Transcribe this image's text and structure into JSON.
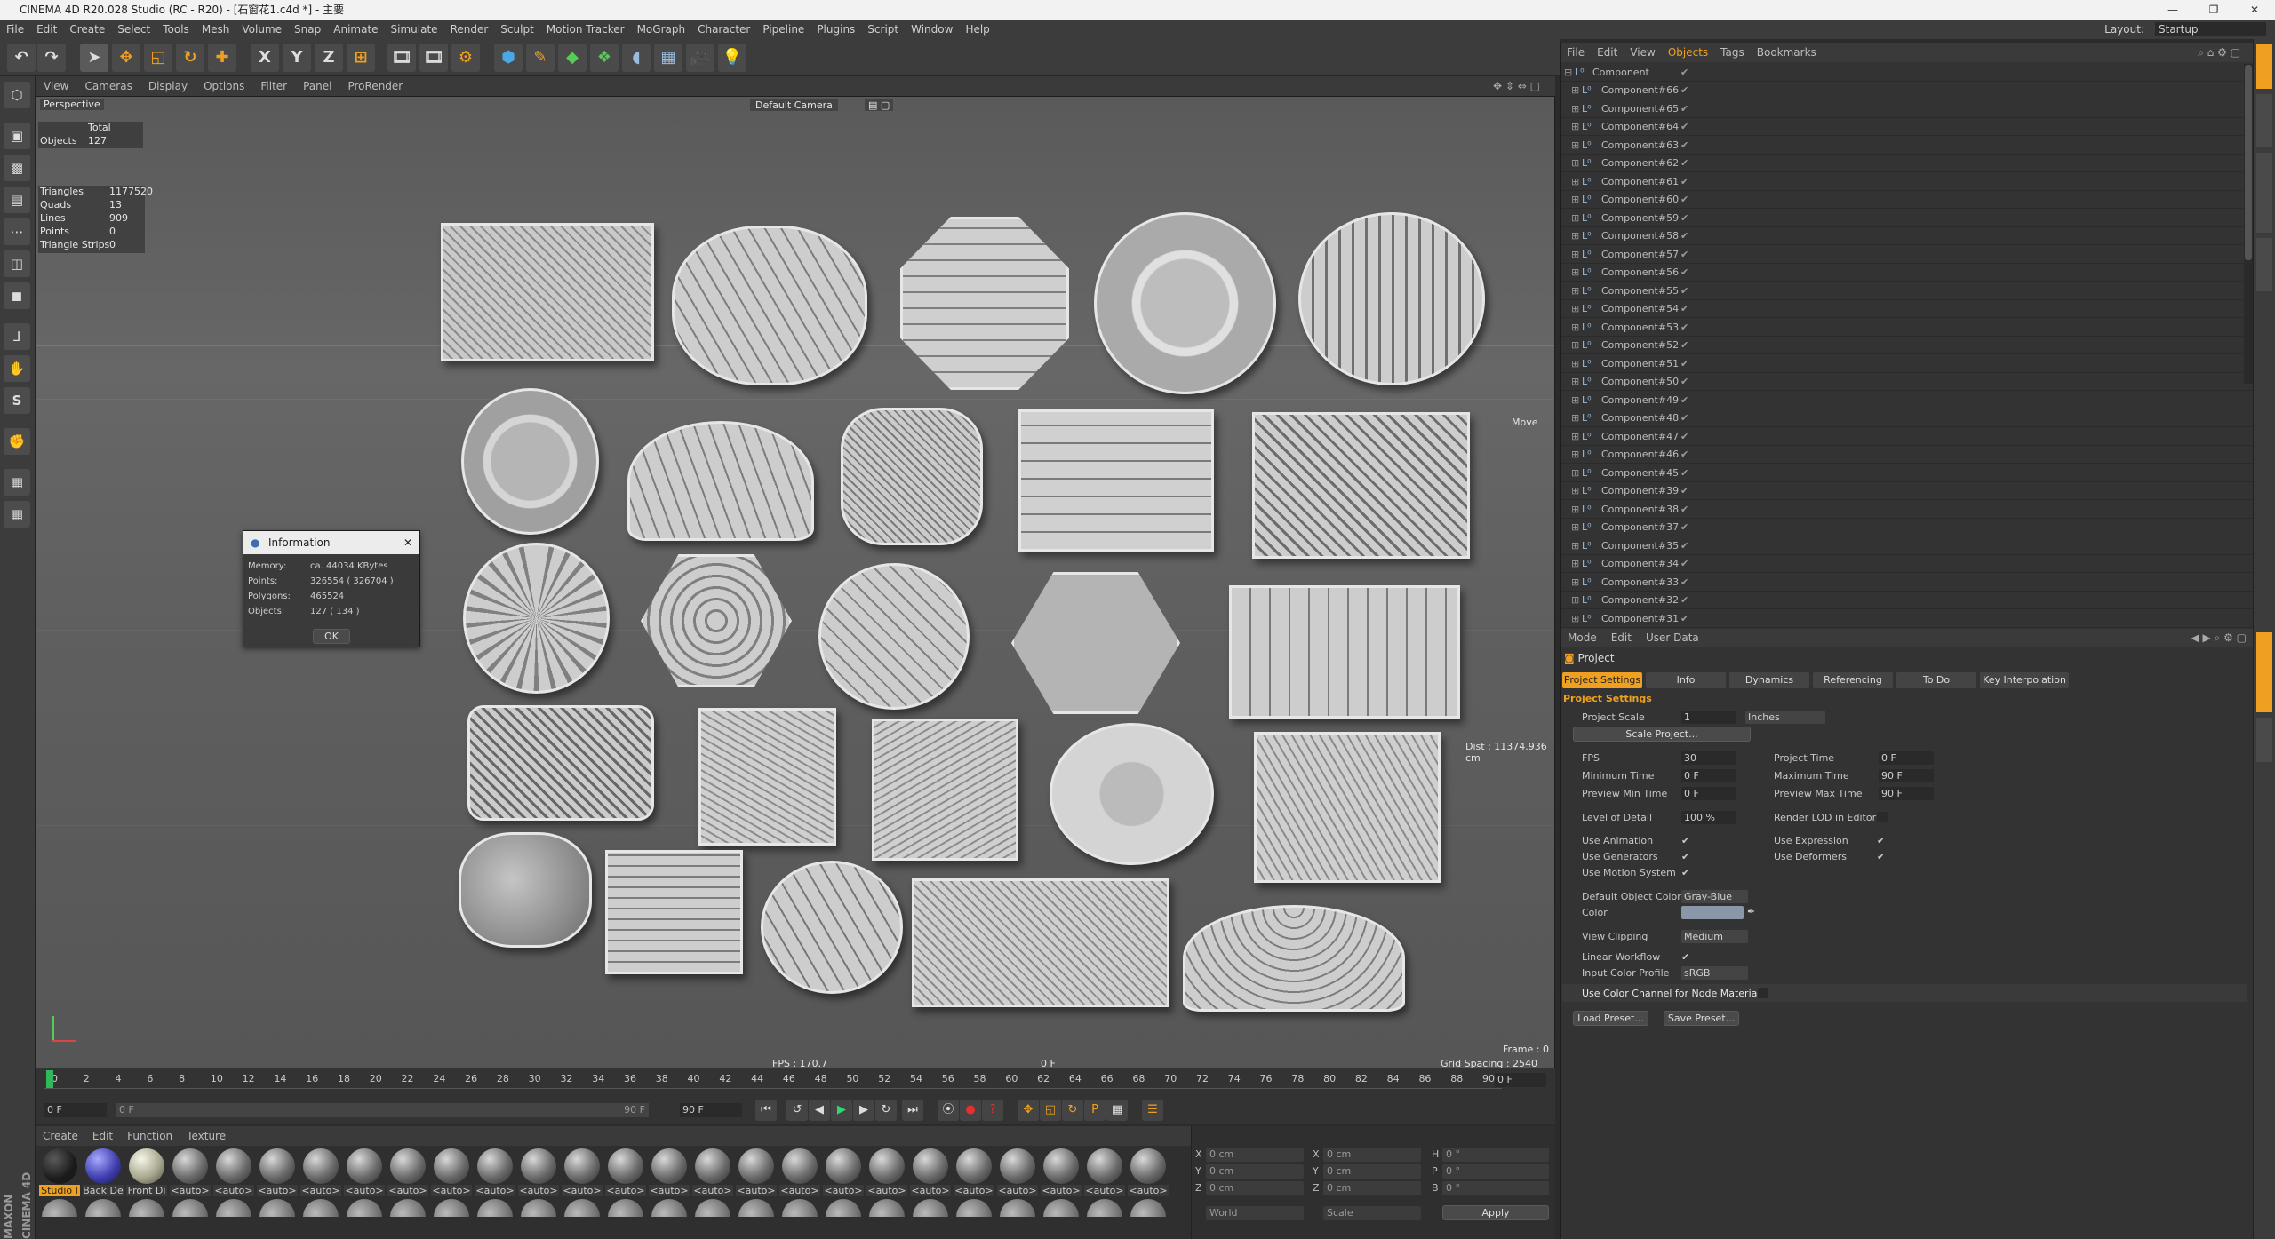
{
  "app": {
    "title": "CINEMA 4D R20.028 Studio (RC - R20) - [石窗花1.c4d *] - 主要",
    "layout_label": "Layout:",
    "layout_value": "Startup"
  },
  "menu": [
    "File",
    "Edit",
    "Create",
    "Select",
    "Tools",
    "Mesh",
    "Volume",
    "Snap",
    "Animate",
    "Simulate",
    "Render",
    "Sculpt",
    "Motion Tracker",
    "MoGraph",
    "Character",
    "Pipeline",
    "Plugins",
    "Script",
    "Window",
    "Help"
  ],
  "toolbar": {
    "x_label": "X",
    "y_label": "Y",
    "z_label": "Z"
  },
  "viewport": {
    "menu": [
      "View",
      "Cameras",
      "Display",
      "Options",
      "Filter",
      "Panel",
      "ProRender"
    ],
    "name": "Perspective",
    "camera": "Default Camera",
    "hud": {
      "total_label": "Total",
      "objects_label": "Objects",
      "objects_value": "127",
      "triangles_label": "Triangles",
      "triangles_value": "1177520",
      "quads_label": "Quads",
      "quads_value": "13",
      "lines_label": "Lines",
      "lines_value": "909",
      "points_label": "Points",
      "points_value": "0",
      "strips_label": "Triangle Strips",
      "strips_value": "0"
    },
    "move_label": "Move",
    "dist": "Dist : 11374.936 cm",
    "fps": "FPS : 170.7",
    "frame_center": "0 F",
    "frame_right": "Frame : 0",
    "grid_spacing": "Grid Spacing : 2540 cm"
  },
  "info_dialog": {
    "title": "Information",
    "memory_label": "Memory:",
    "memory_value": "ca. 44034 KBytes",
    "points_label": "Points:",
    "points_value": "326554 ( 326704 )",
    "polygons_label": "Polygons:",
    "polygons_value": "465524",
    "objects_label": "Objects:",
    "objects_value": "127 ( 134 )",
    "ok": "OK"
  },
  "timeline": {
    "ticks": [
      "0",
      "2",
      "4",
      "6",
      "8",
      "10",
      "12",
      "14",
      "16",
      "18",
      "20",
      "22",
      "24",
      "26",
      "28",
      "30",
      "32",
      "34",
      "36",
      "38",
      "40",
      "42",
      "44",
      "46",
      "48",
      "50",
      "52",
      "54",
      "56",
      "58",
      "60",
      "62",
      "64",
      "66",
      "68",
      "70",
      "72",
      "74",
      "76",
      "78",
      "80",
      "82",
      "84",
      "86",
      "88",
      "90"
    ],
    "end_field": "0 F",
    "start_field": "0 F",
    "range_start": "0 F",
    "range_end": "90 F",
    "max_field": "90 F"
  },
  "materials": {
    "menu": [
      "Create",
      "Edit",
      "Function",
      "Texture"
    ],
    "items": [
      "Studio I",
      "Back De",
      "Front Di",
      "<auto>",
      "<auto>",
      "<auto>",
      "<auto>",
      "<auto>",
      "<auto>",
      "<auto>",
      "<auto>",
      "<auto>",
      "<auto>",
      "<auto>",
      "<auto>",
      "<auto>",
      "<auto>",
      "<auto>",
      "<auto>",
      "<auto>",
      "<auto>",
      "<auto>",
      "<auto>",
      "<auto>",
      "<auto>",
      "<auto>"
    ]
  },
  "coords": {
    "x_label": "X",
    "y_label": "Y",
    "z_label": "Z",
    "px": "0 cm",
    "py": "0 cm",
    "pz": "0 cm",
    "sx_label": "X",
    "sy_label": "Y",
    "sz_label": "Z",
    "sx": "0 cm",
    "sy": "0 cm",
    "sz": "0 cm",
    "h_label": "H",
    "p_label": "P",
    "b_label": "B",
    "h": "0 °",
    "p": "0 °",
    "b": "0 °",
    "world": "World",
    "scale": "Scale",
    "apply": "Apply"
  },
  "objects": {
    "menu": [
      "File",
      "Edit",
      "View",
      "Objects",
      "Tags",
      "Bookmarks"
    ],
    "root": "Component",
    "items": [
      "Component#66",
      "Component#65",
      "Component#64",
      "Component#63",
      "Component#62",
      "Component#61",
      "Component#60",
      "Component#59",
      "Component#58",
      "Component#57",
      "Component#56",
      "Component#55",
      "Component#54",
      "Component#53",
      "Component#52",
      "Component#51",
      "Component#50",
      "Component#49",
      "Component#48",
      "Component#47",
      "Component#46",
      "Component#45",
      "Component#39",
      "Component#38",
      "Component#37",
      "Component#35",
      "Component#34",
      "Component#33",
      "Component#32",
      "Component#31"
    ]
  },
  "attributes": {
    "menu": [
      "Mode",
      "Edit",
      "User Data"
    ],
    "header": "Project",
    "tabs": [
      "Project Settings",
      "Info",
      "Dynamics",
      "Referencing",
      "To Do",
      "Key Interpolation"
    ],
    "section": "Project Settings",
    "project_scale_label": "Project Scale",
    "project_scale_value": "1",
    "project_scale_unit": "Inches",
    "scale_project_btn": "Scale Project...",
    "fps_label": "FPS",
    "fps_value": "30",
    "project_time_label": "Project Time",
    "project_time_value": "0 F",
    "min_time_label": "Minimum Time",
    "min_time_value": "0 F",
    "max_time_label": "Maximum Time",
    "max_time_value": "90 F",
    "prev_min_label": "Preview Min Time",
    "prev_min_value": "0 F",
    "prev_max_label": "Preview Max Time",
    "prev_max_value": "90 F",
    "lod_label": "Level of Detail",
    "lod_value": "100 %",
    "render_lod_label": "Render LOD in Editor",
    "use_anim_label": "Use Animation",
    "use_expr_label": "Use Expression",
    "use_gen_label": "Use Generators",
    "use_def_label": "Use Deformers",
    "use_motion_label": "Use Motion System",
    "default_color_label": "Default Object Color",
    "default_color_value": "Gray-Blue",
    "color_label": "Color",
    "view_clipping_label": "View Clipping",
    "view_clipping_value": "Medium",
    "linear_workflow_label": "Linear Workflow",
    "input_profile_label": "Input Color Profile",
    "input_profile_value": "sRGB",
    "node_material_label": "Use Color Channel for Node Material",
    "load_preset": "Load Preset...",
    "save_preset": "Save Preset..."
  },
  "brand": "MAXON CINEMA 4D",
  "check": "✔",
  "colors": {
    "accent_orange": "#f0a020",
    "tab_active": "#f0a020",
    "panel_bg": "#333333",
    "viewport_bg": "#606060"
  }
}
